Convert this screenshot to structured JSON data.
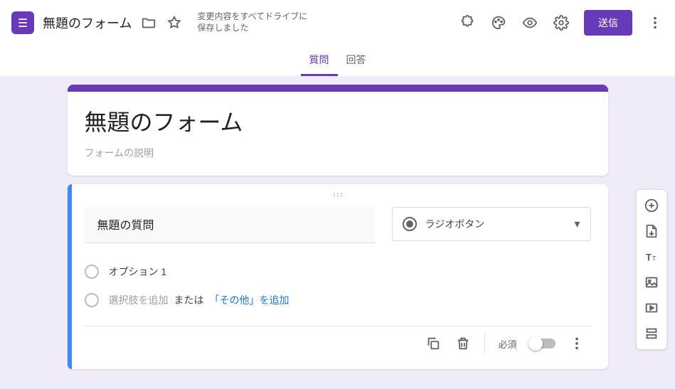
{
  "header": {
    "doc_title": "無題のフォーム",
    "save_status_l1": "変更内容をすべてドライブに",
    "save_status_l2": "保存しました",
    "send_label": "送信"
  },
  "tabs": {
    "questions": "質問",
    "responses": "回答",
    "active": "questions"
  },
  "form": {
    "title": "無題のフォーム",
    "description_placeholder": "フォームの説明"
  },
  "question": {
    "title": "無題の質問",
    "type_label": "ラジオボタン",
    "options": [
      {
        "label": "オプション 1"
      }
    ],
    "add_option_label": "選択肢を追加",
    "or_label": "または",
    "add_other_label": "「その他」を追加",
    "required_label": "必須",
    "required": false
  },
  "icons": {
    "folder": "folder-icon",
    "star": "star-icon",
    "addons": "puzzle-icon",
    "palette": "palette-icon",
    "preview": "eye-icon",
    "settings": "gear-icon",
    "more": "more-vert-icon",
    "copy": "copy-icon",
    "delete": "trash-icon",
    "add_question": "plus-circle-icon",
    "import": "import-icon",
    "add_title": "text-icon",
    "add_image": "image-icon",
    "add_video": "video-icon",
    "add_section": "section-icon"
  }
}
